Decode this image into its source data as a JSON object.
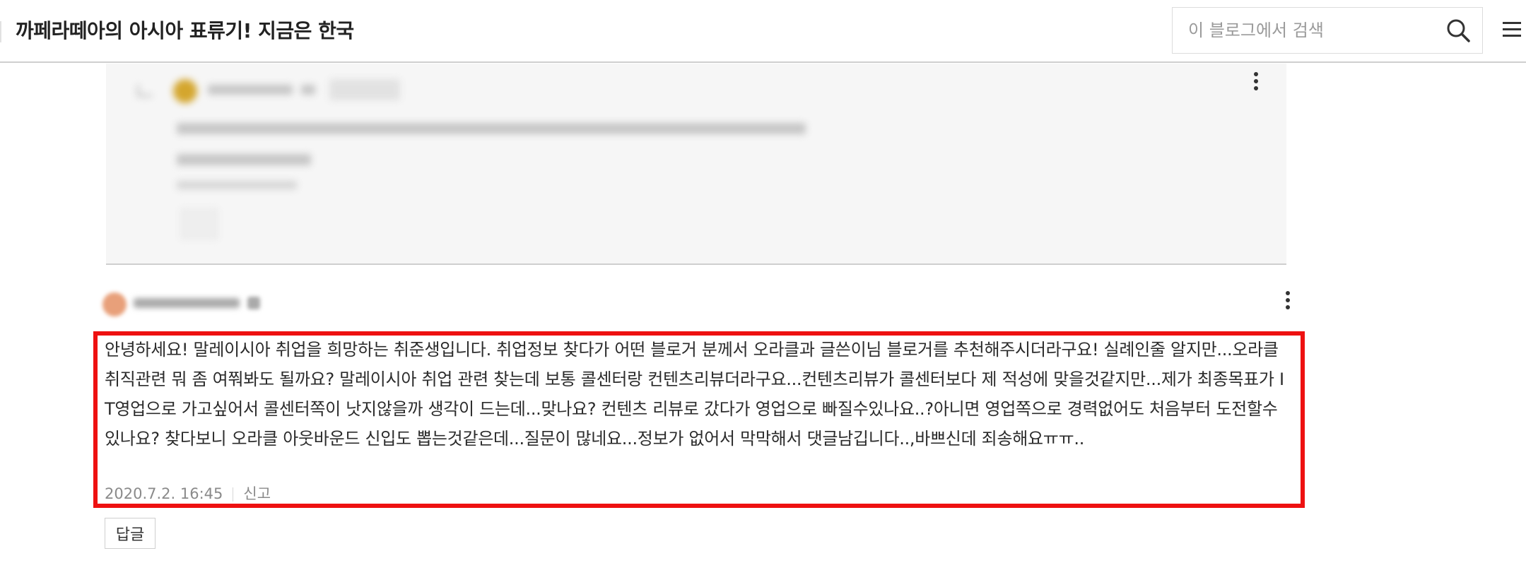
{
  "header": {
    "blog_title": "까페라떼아의 아시아 표류기! 지금은 한국",
    "search_placeholder": "이 블로그에서 검색"
  },
  "comment": {
    "text": "안녕하세요! 말레이시아 취업을 희망하는 취준생입니다. 취업정보 찾다가 어떤 블로거 분께서 오라클과 글쓴이님 블로거를 추천해주시더라구요! 실례인줄 알지만...오라클 취직관련 뭐 좀 여쭤봐도 될까요? 말레이시아 취업 관련 찾는데 보통 콜센터랑 컨텐츠리뷰더라구요...컨텐츠리뷰가 콜센터보다 제 적성에 맞을것같지만...제가 최종목표가 IT영업으로 가고싶어서 콜센터쪽이 낫지않을까 생각이 드는데...맞나요? 컨텐츠 리뷰로 갔다가 영업으로 빠질수있나요..?아니면 영업쪽으로 경력없어도 처음부터 도전할수있나요? 찾다보니 오라클 아웃바운드 신입도 뽑는것같은데...질문이 많네요...정보가 없어서 막막해서 댓글남깁니다..,바쁘신데 죄송해요ㅠㅠ..",
    "date": "2020.7.2. 16:45",
    "report_label": "신고",
    "reply_label": "답글"
  },
  "icons": {
    "search": "search-icon",
    "menu": "hamburger-menu-icon",
    "more": "more-vertical-icon"
  },
  "colors": {
    "highlight": "#ee1111"
  }
}
